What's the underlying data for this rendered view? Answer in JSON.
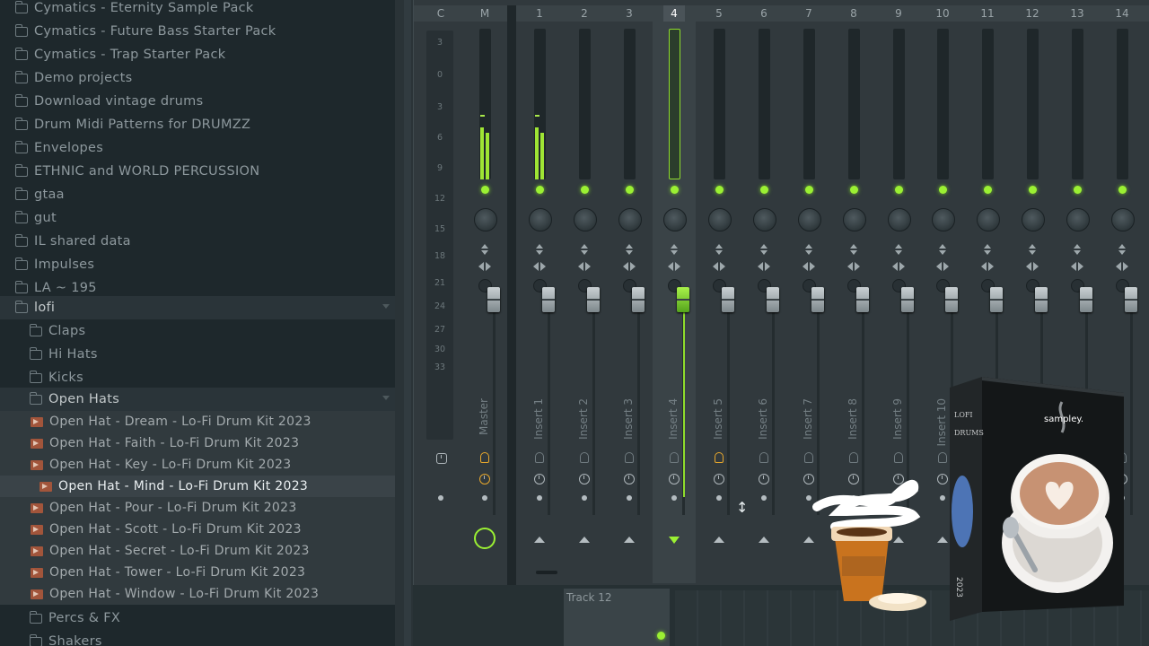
{
  "browser": {
    "items": [
      {
        "label": "Cymatics - Eternity Sample Pack",
        "type": "folder",
        "indent": 0
      },
      {
        "label": "Cymatics - Future Bass Starter Pack",
        "type": "folder",
        "indent": 0
      },
      {
        "label": "Cymatics - Trap Starter Pack",
        "type": "folder",
        "indent": 0
      },
      {
        "label": "Demo projects",
        "type": "folder",
        "indent": 0
      },
      {
        "label": "Download vintage drums",
        "type": "folder",
        "indent": 0
      },
      {
        "label": "Drum Midi Patterns for DRUMZZ",
        "type": "folder",
        "indent": 0
      },
      {
        "label": "Envelopes",
        "type": "folder",
        "indent": 0
      },
      {
        "label": "ETHNIC and WORLD PERCUSSION",
        "type": "folder",
        "indent": 0
      },
      {
        "label": "gtaa",
        "type": "folder",
        "indent": 0
      },
      {
        "label": "gut",
        "type": "folder",
        "indent": 0
      },
      {
        "label": "IL shared data",
        "type": "folder",
        "indent": 0
      },
      {
        "label": "Impulses",
        "type": "folder",
        "indent": 0
      },
      {
        "label": "LA ~ 195",
        "type": "folder",
        "indent": 0
      },
      {
        "label": "lofi",
        "type": "folder-open",
        "indent": 0
      },
      {
        "label": "Claps",
        "type": "folder",
        "indent": 1
      },
      {
        "label": "Hi Hats",
        "type": "folder",
        "indent": 1
      },
      {
        "label": "Kicks",
        "type": "folder",
        "indent": 1
      },
      {
        "label": "Open Hats",
        "type": "folder-open",
        "indent": 1
      },
      {
        "label": "Open Hat - Dream - Lo-Fi Drum Kit 2023",
        "type": "file",
        "indent": 1
      },
      {
        "label": "Open Hat - Faith - Lo-Fi Drum Kit 2023",
        "type": "file",
        "indent": 1
      },
      {
        "label": "Open Hat - Key - Lo-Fi Drum Kit 2023",
        "type": "file",
        "indent": 1
      },
      {
        "label": "Open Hat - Mind - Lo-Fi Drum Kit 2023",
        "type": "file",
        "indent": 1
      },
      {
        "label": "Open Hat - Pour - Lo-Fi Drum Kit 2023",
        "type": "file",
        "indent": 1
      },
      {
        "label": "Open Hat - Scott - Lo-Fi Drum Kit 2023",
        "type": "file",
        "indent": 1
      },
      {
        "label": "Open Hat - Secret - Lo-Fi Drum Kit 2023",
        "type": "file",
        "indent": 1
      },
      {
        "label": "Open Hat - Tower - Lo-Fi Drum Kit 2023",
        "type": "file",
        "indent": 1
      },
      {
        "label": "Open Hat - Window - Lo-Fi Drum Kit 2023",
        "type": "file",
        "indent": 1
      },
      {
        "label": "Percs & FX",
        "type": "folder",
        "indent": 1
      },
      {
        "label": "Shakers",
        "type": "folder",
        "indent": 1
      }
    ]
  },
  "mixer": {
    "header": [
      "C",
      "M",
      "1",
      "2",
      "3",
      "4",
      "5",
      "6",
      "7",
      "8",
      "9",
      "10",
      "11",
      "12",
      "13",
      "14"
    ],
    "ruler_ticks": [
      "3",
      "0",
      "3",
      "6",
      "9",
      "12",
      "15",
      "18",
      "21",
      "24",
      "27",
      "30",
      "33"
    ],
    "strips": [
      "Master",
      "Insert 1",
      "Insert 2",
      "Insert 3",
      "Insert 4",
      "Insert 5",
      "Insert 6",
      "Insert 7",
      "Insert 8",
      "Insert 9",
      "Insert 10"
    ],
    "selected_strip": "4"
  },
  "playlist": {
    "track_label": "Track 12"
  },
  "product": {
    "brand": "sampley.",
    "title_line1": "LOFI",
    "title_line2": "DRUMS",
    "year": "2023"
  },
  "colors": {
    "accent": "#9bf033",
    "file_icon": "#a2553b",
    "background": "#1e282c"
  }
}
